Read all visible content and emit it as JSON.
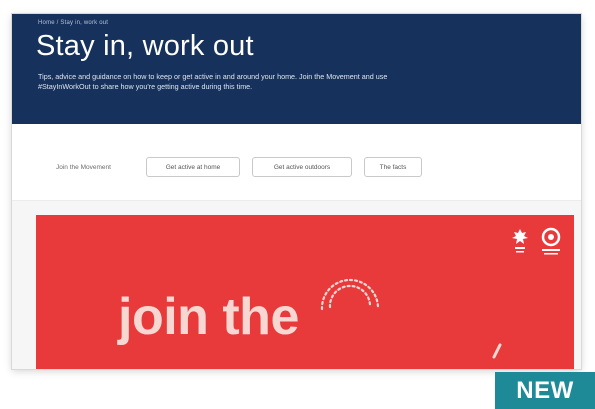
{
  "hero": {
    "breadcrumb": "Home / Stay in, work out",
    "title": "Stay in, work out",
    "description": "Tips, advice and guidance on how to keep or get active in and around your home. Join the Movement and use #StayInWorkOut to share how you're getting active during this time."
  },
  "filters": {
    "label": "Join the Movement",
    "buttons": [
      "Get active at home",
      "Get active outdoors",
      "The facts"
    ]
  },
  "banner": {
    "headline": "join the",
    "background_color": "#e83a3b"
  },
  "badge": {
    "label": "NEW",
    "color": "#1e8a98"
  },
  "colors": {
    "hero_background": "#15315c"
  }
}
